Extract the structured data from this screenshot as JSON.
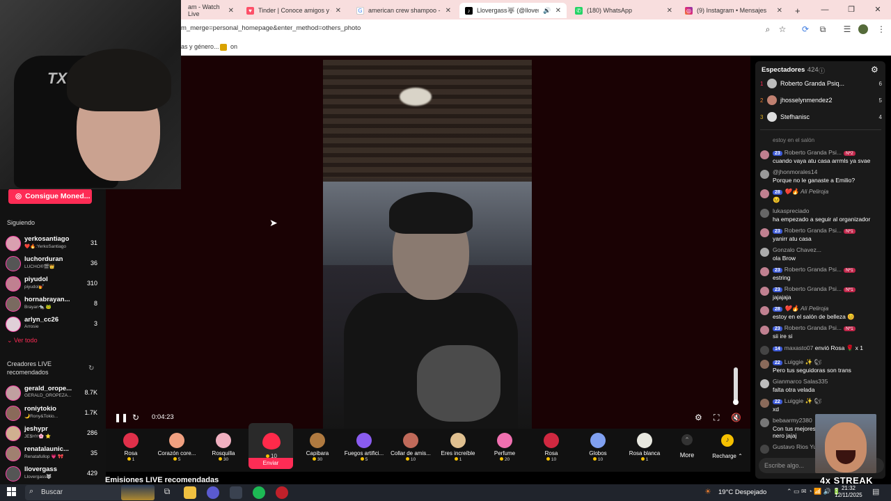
{
  "browser": {
    "tabs": [
      {
        "title": "am - Watch Live",
        "icon": "twitch-icon"
      },
      {
        "title": "Tinder | Conoce amigos y gent",
        "icon": "tinder-icon"
      },
      {
        "title": "american crew shampoo - Busc",
        "icon": "google-icon"
      },
      {
        "title": "Llovergass🐺 (@llovergass",
        "icon": "tiktok-icon"
      },
      {
        "title": "(180) WhatsApp",
        "icon": "whatsapp-icon"
      },
      {
        "title": "(9) Instagram • Mensajes",
        "icon": "instagram-icon"
      }
    ],
    "new_tab": "+",
    "url": "m_merge=personal_homepage&enter_method=others_photo",
    "bookmarks": [
      {
        "label": "as y género..."
      },
      {
        "label": "on"
      }
    ]
  },
  "sidebar": {
    "coins_button": "Consigue Moned...",
    "following_title": "Siguiendo",
    "following": [
      {
        "name": "yerkosantiago",
        "sub": "❤️🔥:YerkoSantiago",
        "count": "31"
      },
      {
        "name": "luchorduran",
        "sub": "LUCHO®🎬👑",
        "count": "36"
      },
      {
        "name": "piyudol",
        "sub": "piyudol💅",
        "count": "310"
      },
      {
        "name": "hornabrayan...",
        "sub": "Brayan🐀 🐸",
        "count": "8"
      },
      {
        "name": "arlyn_cc26",
        "sub": "Arrosie",
        "count": "3"
      }
    ],
    "see_all": "Ver todo",
    "recommended_title": "Creadores LIVE recomendados",
    "recommended": [
      {
        "name": "gerald_orope...",
        "sub": "GERALD_OROPEZA...",
        "count": "8.7K"
      },
      {
        "name": "roniytokio",
        "sub": "🌙Rony&Tokio...",
        "count": "1.7K"
      },
      {
        "name": "jeshypr",
        "sub": "JE$HY🌸 ⭐",
        "count": "286"
      },
      {
        "name": "renatalaunic...",
        "sub": "Renatafullop 💗 🎀",
        "count": "35"
      },
      {
        "name": "llovergass",
        "sub": "Llovergass🐺",
        "count": "429"
      }
    ]
  },
  "player": {
    "time": "0:04:23",
    "volume_level": 1.0
  },
  "gifts": {
    "selected_send": "Enviar",
    "items": [
      {
        "name": "Rosa",
        "price": "1",
        "color": "#e0304a"
      },
      {
        "name": "Corazón core...",
        "price": "5",
        "color": "#f0a080"
      },
      {
        "name": "Rosquilla",
        "price": "30",
        "color": "#f0b0c0"
      },
      {
        "name": "",
        "price": "10",
        "color": "#ff2a4a"
      },
      {
        "name": "Capibara",
        "price": "30",
        "color": "#b07a40"
      },
      {
        "name": "Fuegos artifici...",
        "price": "5",
        "color": "#8a5cf0"
      },
      {
        "name": "Collar de amis...",
        "price": "10",
        "color": "#c06a5a"
      },
      {
        "name": "Eres increíble",
        "price": "1",
        "color": "#e0c090"
      },
      {
        "name": "Perfume",
        "price": "20",
        "color": "#f070b0"
      },
      {
        "name": "Rosa",
        "price": "10",
        "color": "#d02840"
      },
      {
        "name": "Globos",
        "price": "10",
        "color": "#80a0f0"
      },
      {
        "name": "Rosa blanca",
        "price": "1",
        "color": "#e8e8e0"
      }
    ],
    "more": "More",
    "recharge": "Recharge"
  },
  "page": {
    "bottom_heading": "Emisiones LIVE recomendadas"
  },
  "chat": {
    "viewers_title": "Espectadores",
    "viewers_count": "· 424",
    "top_viewers": [
      {
        "rank": "1",
        "name": "Roberto Granda Psiq...",
        "score": "6"
      },
      {
        "rank": "2",
        "name": "jhosselynmendez2",
        "score": "5"
      },
      {
        "rank": "3",
        "name": "Stefhanisc",
        "score": "4"
      }
    ],
    "partial": "estoy en el salón",
    "messages": [
      {
        "badge": "23",
        "user": "Roberto Granda Psi...",
        "rank": "Nº2",
        "text": "cuando vaya atu casa arrmls ya svae"
      },
      {
        "badge": "",
        "user": "@jhonmorales14",
        "rank": "",
        "text": "Porque no le ganaste a Emilio?"
      },
      {
        "badge": "28",
        "user": "❤️🔥 Ali Peliroja",
        "rank": "",
        "text": "😣"
      },
      {
        "badge": "",
        "user": "lukaspreciado",
        "rank": "",
        "text": " ha empezado a seguir al organizador"
      },
      {
        "badge": "23",
        "user": "Roberto Granda Psi...",
        "rank": "Nº1",
        "text": "yanirr atu casa"
      },
      {
        "badge": "",
        "user": "Gonzalo Chavez...",
        "rank": "",
        "text": "ola Brow"
      },
      {
        "badge": "23",
        "user": "Roberto Granda Psi...",
        "rank": "Nº1",
        "text": "estring"
      },
      {
        "badge": "23",
        "user": "Roberto Granda Psi...",
        "rank": "Nº1",
        "text": "jajajaja"
      },
      {
        "badge": "28",
        "user": "❤️🔥 Ali Peliroja",
        "rank": "",
        "text": "estoy en el salón de belleza 😊"
      },
      {
        "badge": "23",
        "user": "Roberto Granda Psi...",
        "rank": "Nº1",
        "text": "sii ire si"
      }
    ],
    "gift_line": {
      "badge": "14",
      "user": "maxasto07",
      "text": "envió Rosa 🌹 x 1"
    },
    "messages2": [
      {
        "badge": "22",
        "user": "Luiggie",
        "text": "Pero tus seguidoras son trans"
      },
      {
        "badge": "",
        "user": "Gianmarco Salas335",
        "text": "falta otra velada"
      },
      {
        "badge": "22",
        "user": "Luiggie",
        "text": "xd"
      },
      {
        "badge": "",
        "user": "bebaarmy2380",
        "text": "Con tus mejores..."
      },
      {
        "badge": "",
        "user": "",
        "text": "nero jajaj"
      }
    ],
    "last_user": "Gustavo Rios Yu...",
    "input_placeholder": "Escribe algo..."
  },
  "overlay": {
    "webcam_brand": "TX",
    "streak": "4x STREAK"
  },
  "taskbar": {
    "search": "Buscar",
    "weather": "19°C  Despejado",
    "time": "21:32",
    "date": "12/11/2025"
  },
  "colors": {
    "accent": "#fe2c55",
    "tab_bar": "#f8dede",
    "video_bg": "#1a0204",
    "taskbar": "#20242c"
  }
}
